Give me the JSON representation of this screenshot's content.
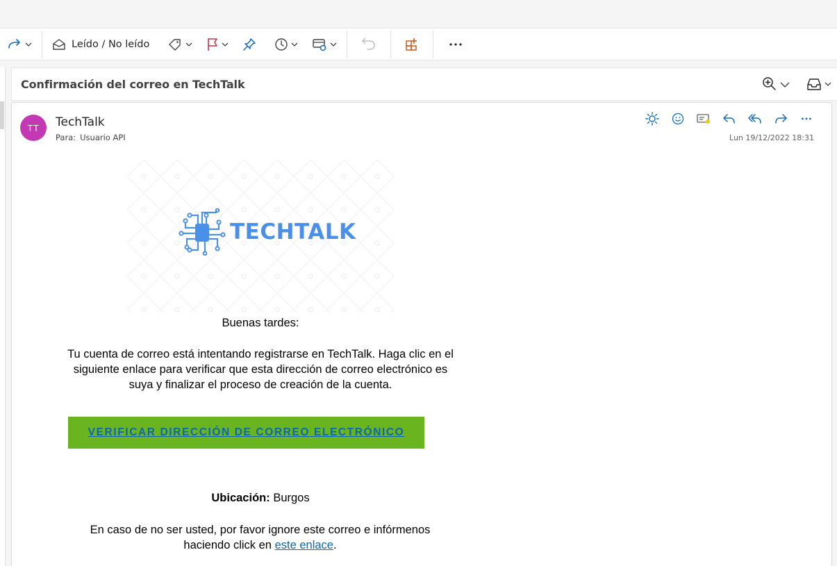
{
  "toolbar": {
    "mark_read_label": "Leído / No leído"
  },
  "message": {
    "subject": "Confirmación del correo en TechTalk",
    "avatar_initials": "TT",
    "sender": "TechTalk",
    "to_label": "Para:",
    "to_value": "Usuario API",
    "datetime": "Lun 19/12/2022 18:31"
  },
  "email_body": {
    "logo_text": "TECHTALK",
    "greeting": "Buenas tardes:",
    "paragraph": "Tu cuenta de correo está intentando registrarse en TechTalk. Haga clic en el siguiente enlace para verificar que esta dirección de correo electrónico es suya y finalizar el proceso de creación de la cuenta.",
    "cta_label": "VERIFICAR DIRECCIÓN DE CORREO ELECTRÓNICO",
    "location_label": "Ubicación:",
    "location_value": "Burgos",
    "footer_text": "En caso de no ser usted, por favor ignore este correo e infórmenos haciendo click en",
    "footer_link": "este enlace",
    "footer_end": "."
  },
  "icons": {
    "toolbar": [
      "forward-icon",
      "envelope-open-icon",
      "tag-icon",
      "flag-icon",
      "pin-icon",
      "clock-icon",
      "rules-icon",
      "undo-icon",
      "apps-icon",
      "more-icon"
    ],
    "header": [
      "sun-icon",
      "emoji-icon",
      "immersive-reader-icon",
      "reply-icon",
      "reply-all-icon",
      "forward-icon",
      "more-icon"
    ],
    "subject_bar": [
      "zoom-icon",
      "inbox-icon"
    ]
  },
  "colors": {
    "accent": "#0f6cbd",
    "flag": "#c4314b",
    "apps": "#ca5010",
    "avatar": "#c239b3",
    "logo": "#4a8fe8",
    "cta_bg": "#6ab51f",
    "link": "#0a67b3"
  }
}
